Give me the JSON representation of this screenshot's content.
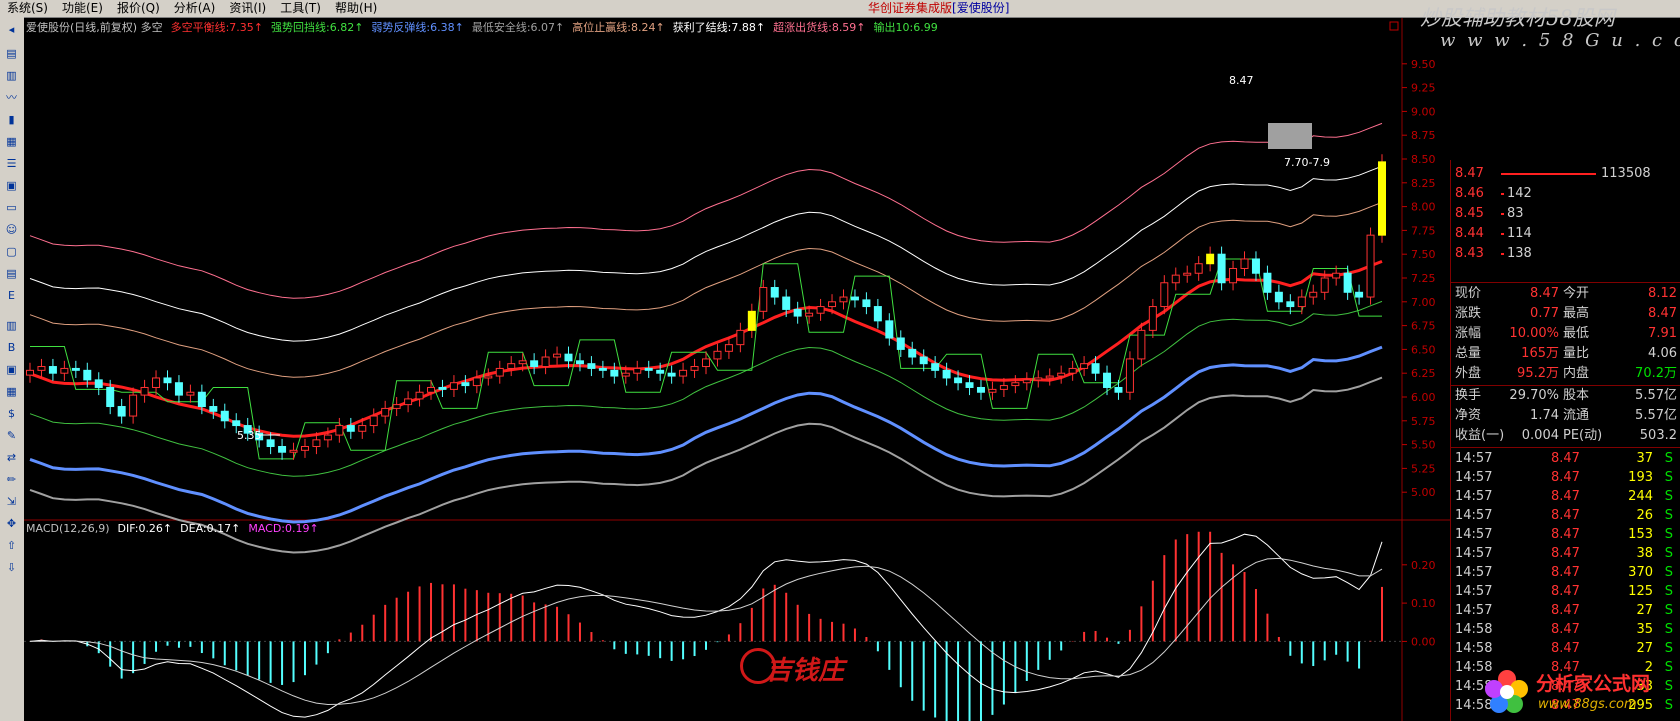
{
  "menu": {
    "items": [
      "系统(S)",
      "功能(E)",
      "报价(Q)",
      "分析(A)",
      "资讯(I)",
      "工具(T)",
      "帮助(H)"
    ],
    "title": "华创证券集成版",
    "stock_tag": "[爱使股份]"
  },
  "watermark_top": {
    "line1": "炒股辅助教材58股网",
    "line2": "w w w . 5 8 G u . c o m"
  },
  "watermark_mid": "吉钱庄",
  "watermark_bottom": {
    "name": "分析家公式网",
    "url": "www.88gs.com"
  },
  "main_legend": [
    {
      "text": "爱使股份(日线,前复权) 多空",
      "color": "#c0c0c0"
    },
    {
      "text": "多空平衡线:7.35↑",
      "color": "#ff3030"
    },
    {
      "text": "强势回挡线:6.82↑",
      "color": "#40e040"
    },
    {
      "text": "弱势反弹线:6.38↑",
      "color": "#6090ff"
    },
    {
      "text": "最低安全线:6.07↑",
      "color": "#a0a0a0"
    },
    {
      "text": "高位止赢线:8.24↑",
      "color": "#e0a080"
    },
    {
      "text": "获利了结线:7.88↑",
      "color": "#ffffff"
    },
    {
      "text": "超涨出货线:8.59↑",
      "color": "#ff7090"
    },
    {
      "text": "输出10:6.99",
      "color": "#40e040"
    }
  ],
  "macd_legend": [
    {
      "text": "MACD(12,26,9)",
      "color": "#c0c0c0"
    },
    {
      "text": "DIF:0.26↑",
      "color": "#ffffff"
    },
    {
      "text": "DEA:0.17↑",
      "color": "#ffffff"
    },
    {
      "text": "MACD:0.19↑",
      "color": "#ff40ff"
    }
  ],
  "annotations": {
    "low": "5.35",
    "high": "8.47",
    "range": "7.70-7.9"
  },
  "chart_data": {
    "type": "candlestick",
    "price_axis": {
      "ylim": [
        4.75,
        9.75
      ],
      "ticks": [
        "9.50",
        "9.25",
        "9.00",
        "8.75",
        "8.50",
        "8.25",
        "8.00",
        "7.75",
        "7.50",
        "7.25",
        "7.00",
        "6.75",
        "6.50",
        "6.25",
        "6.00",
        "5.75",
        "5.50",
        "5.25",
        "5.00"
      ]
    },
    "macd_axis": {
      "ylim": [
        -0.2,
        0.27
      ],
      "ticks": [
        "0.20",
        "0.10",
        "0.00"
      ]
    },
    "close": [
      6.28,
      6.32,
      6.25,
      6.3,
      6.28,
      6.18,
      6.1,
      5.9,
      5.8,
      6.02,
      6.1,
      6.2,
      6.15,
      6.02,
      6.05,
      5.9,
      5.85,
      5.75,
      5.7,
      5.62,
      5.55,
      5.48,
      5.42,
      5.44,
      5.48,
      5.55,
      5.6,
      5.7,
      5.64,
      5.7,
      5.8,
      5.88,
      5.92,
      5.98,
      6.05,
      6.1,
      6.08,
      6.15,
      6.12,
      6.2,
      6.22,
      6.3,
      6.35,
      6.38,
      6.32,
      6.42,
      6.45,
      6.38,
      6.35,
      6.3,
      6.28,
      6.22,
      6.25,
      6.3,
      6.28,
      6.25,
      6.22,
      6.28,
      6.32,
      6.4,
      6.48,
      6.55,
      6.7,
      6.9,
      7.15,
      7.05,
      6.92,
      6.85,
      6.88,
      6.95,
      7.0,
      7.05,
      7.02,
      6.95,
      6.8,
      6.62,
      6.5,
      6.42,
      6.35,
      6.28,
      6.2,
      6.15,
      6.1,
      6.05,
      6.08,
      6.12,
      6.15,
      6.18,
      6.2,
      6.22,
      6.25,
      6.3,
      6.35,
      6.25,
      6.1,
      6.05,
      6.4,
      6.7,
      6.95,
      7.2,
      7.28,
      7.3,
      7.4,
      7.5,
      7.2,
      7.35,
      7.45,
      7.3,
      7.1,
      7.0,
      6.95,
      7.05,
      7.1,
      7.25,
      7.3,
      7.1,
      7.05,
      7.7,
      8.47
    ],
    "indicators": [
      {
        "name": "多空平衡线",
        "value": 7.35
      },
      {
        "name": "强势回挡线",
        "value": 6.82
      },
      {
        "name": "弱势反弹线",
        "value": 6.38
      },
      {
        "name": "最低安全线",
        "value": 6.07
      },
      {
        "name": "高位止赢线",
        "value": 8.24
      },
      {
        "name": "获利了结线",
        "value": 7.88
      },
      {
        "name": "超涨出货线",
        "value": 8.59
      },
      {
        "name": "输出10",
        "value": 6.99
      }
    ],
    "macd": {
      "DIF": 0.26,
      "DEA": 0.17,
      "MACD": 0.19
    }
  },
  "quote": {
    "book": [
      {
        "price": "8.47",
        "vol": "113508"
      },
      {
        "price": "8.46",
        "vol": "142"
      },
      {
        "price": "8.45",
        "vol": "83"
      },
      {
        "price": "8.44",
        "vol": "114"
      },
      {
        "price": "8.43",
        "vol": "138"
      }
    ],
    "stats": [
      [
        "现价",
        "8.47",
        "今开",
        "8.12"
      ],
      [
        "涨跌",
        "0.77",
        "最高",
        "8.47"
      ],
      [
        "涨幅",
        "10.00%",
        "最低",
        "7.91"
      ],
      [
        "总量",
        "165万",
        "量比",
        "4.06"
      ],
      [
        "外盘",
        "95.2万",
        "内盘",
        "70.2万"
      ],
      [
        "换手",
        "29.70%",
        "股本",
        "5.57亿"
      ],
      [
        "净资",
        "1.74",
        "流通",
        "5.57亿"
      ],
      [
        "收益(一)",
        "0.004",
        "PE(动)",
        "503.2"
      ]
    ],
    "ticks": [
      [
        "14:57",
        "8.47",
        "37",
        "S"
      ],
      [
        "14:57",
        "8.47",
        "193",
        "S"
      ],
      [
        "14:57",
        "8.47",
        "244",
        "S"
      ],
      [
        "14:57",
        "8.47",
        "26",
        "S"
      ],
      [
        "14:57",
        "8.47",
        "153",
        "S"
      ],
      [
        "14:57",
        "8.47",
        "38",
        "S"
      ],
      [
        "14:57",
        "8.47",
        "370",
        "S"
      ],
      [
        "14:57",
        "8.47",
        "125",
        "S"
      ],
      [
        "14:57",
        "8.47",
        "27",
        "S"
      ],
      [
        "14:58",
        "8.47",
        "35",
        "S"
      ],
      [
        "14:58",
        "8.47",
        "27",
        "S"
      ],
      [
        "14:58",
        "8.47",
        "2",
        "S"
      ],
      [
        "14:58",
        "8.47",
        "33",
        "S"
      ],
      [
        "14:58",
        "8.47",
        "295",
        "S"
      ]
    ]
  }
}
